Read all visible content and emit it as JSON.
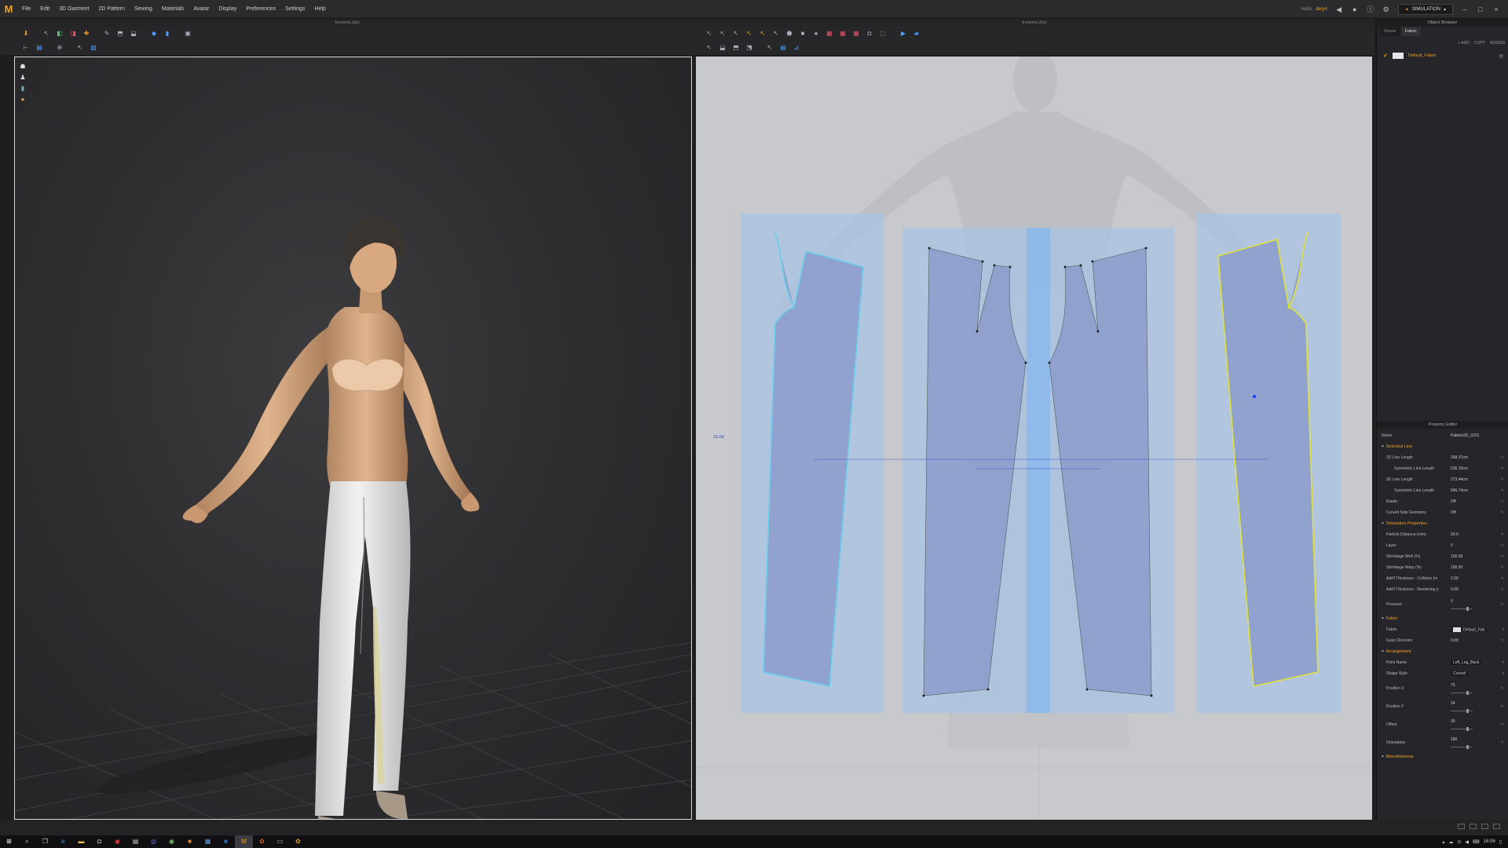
{
  "app": {
    "logo": "M",
    "menu": [
      "File",
      "Edit",
      "3D Garment",
      "2D Pattern",
      "Sewing",
      "Materials",
      "Avatar",
      "Display",
      "Preferences",
      "Settings",
      "Help"
    ],
    "user_label": "Hello,",
    "user_name": "daryn",
    "mode_button": "SIMULATION"
  },
  "view3d": {
    "title": "trousers.Zprj"
  },
  "view2d": {
    "title": "trousers.Zprj",
    "scale_label": "15.0d"
  },
  "object_browser": {
    "title": "Object Browser",
    "tabs": [
      "Scene",
      "Fabric"
    ],
    "active_tab": "Fabric",
    "actions": [
      "+ ADD",
      "COPY",
      "ASSIGN"
    ],
    "fabric_name": "Default_Fabric"
  },
  "property_editor": {
    "title": "Property Editor",
    "name_label": "Name",
    "name_value": "Pattern2D_3221",
    "sections": {
      "selected_line": "Selected Line",
      "simulation": "Simulation Properties",
      "fabric": "Fabric",
      "arrangement": "Arrangement",
      "misc": "Miscellaneous"
    },
    "selected_line": [
      {
        "k": "2D Line Length",
        "v": "268.37cm",
        "sub": false
      },
      {
        "k": "Symmetric Line Length",
        "v": "536.15cm",
        "sub": true
      },
      {
        "k": "3D Line Length",
        "v": "273.44cm",
        "sub": false
      },
      {
        "k": "Symmetric Line Length",
        "v": "546.74cm",
        "sub": true
      },
      {
        "k": "Elastic",
        "v": "Off",
        "sub": false
      },
      {
        "k": "Curved Side Geometry",
        "v": "Off",
        "sub": false
      }
    ],
    "simulation": [
      {
        "k": "Particle Distance (mm)",
        "v": "20.0"
      },
      {
        "k": "Layer",
        "v": "0"
      },
      {
        "k": "Shrinkage Weft (%)",
        "v": "100.00"
      },
      {
        "k": "Shrinkage Warp (%)",
        "v": "100.00"
      },
      {
        "k": "Add'l Thickness - Collision (m",
        "v": "2.50"
      },
      {
        "k": "Add'l Thickness - Rendering (r",
        "v": "0.00"
      }
    ],
    "pressure": {
      "k": "Pressure",
      "v": "0"
    },
    "fabric": [
      {
        "k": "Fabric",
        "v": "Default_Fab"
      },
      {
        "k": "Grain Direction",
        "v": "0.00"
      }
    ],
    "arrangement": [
      {
        "k": "Point Name",
        "v": "Left_Leg_Back"
      },
      {
        "k": "Shape Style",
        "v": "Curved"
      }
    ],
    "arrangement_sliders": [
      {
        "k": "Position X",
        "v": "75"
      },
      {
        "k": "Position Y",
        "v": "24"
      },
      {
        "k": "Offset",
        "v": "30"
      },
      {
        "k": "Orientation",
        "v": "180"
      }
    ]
  },
  "taskbar": {
    "time": "16:06"
  }
}
